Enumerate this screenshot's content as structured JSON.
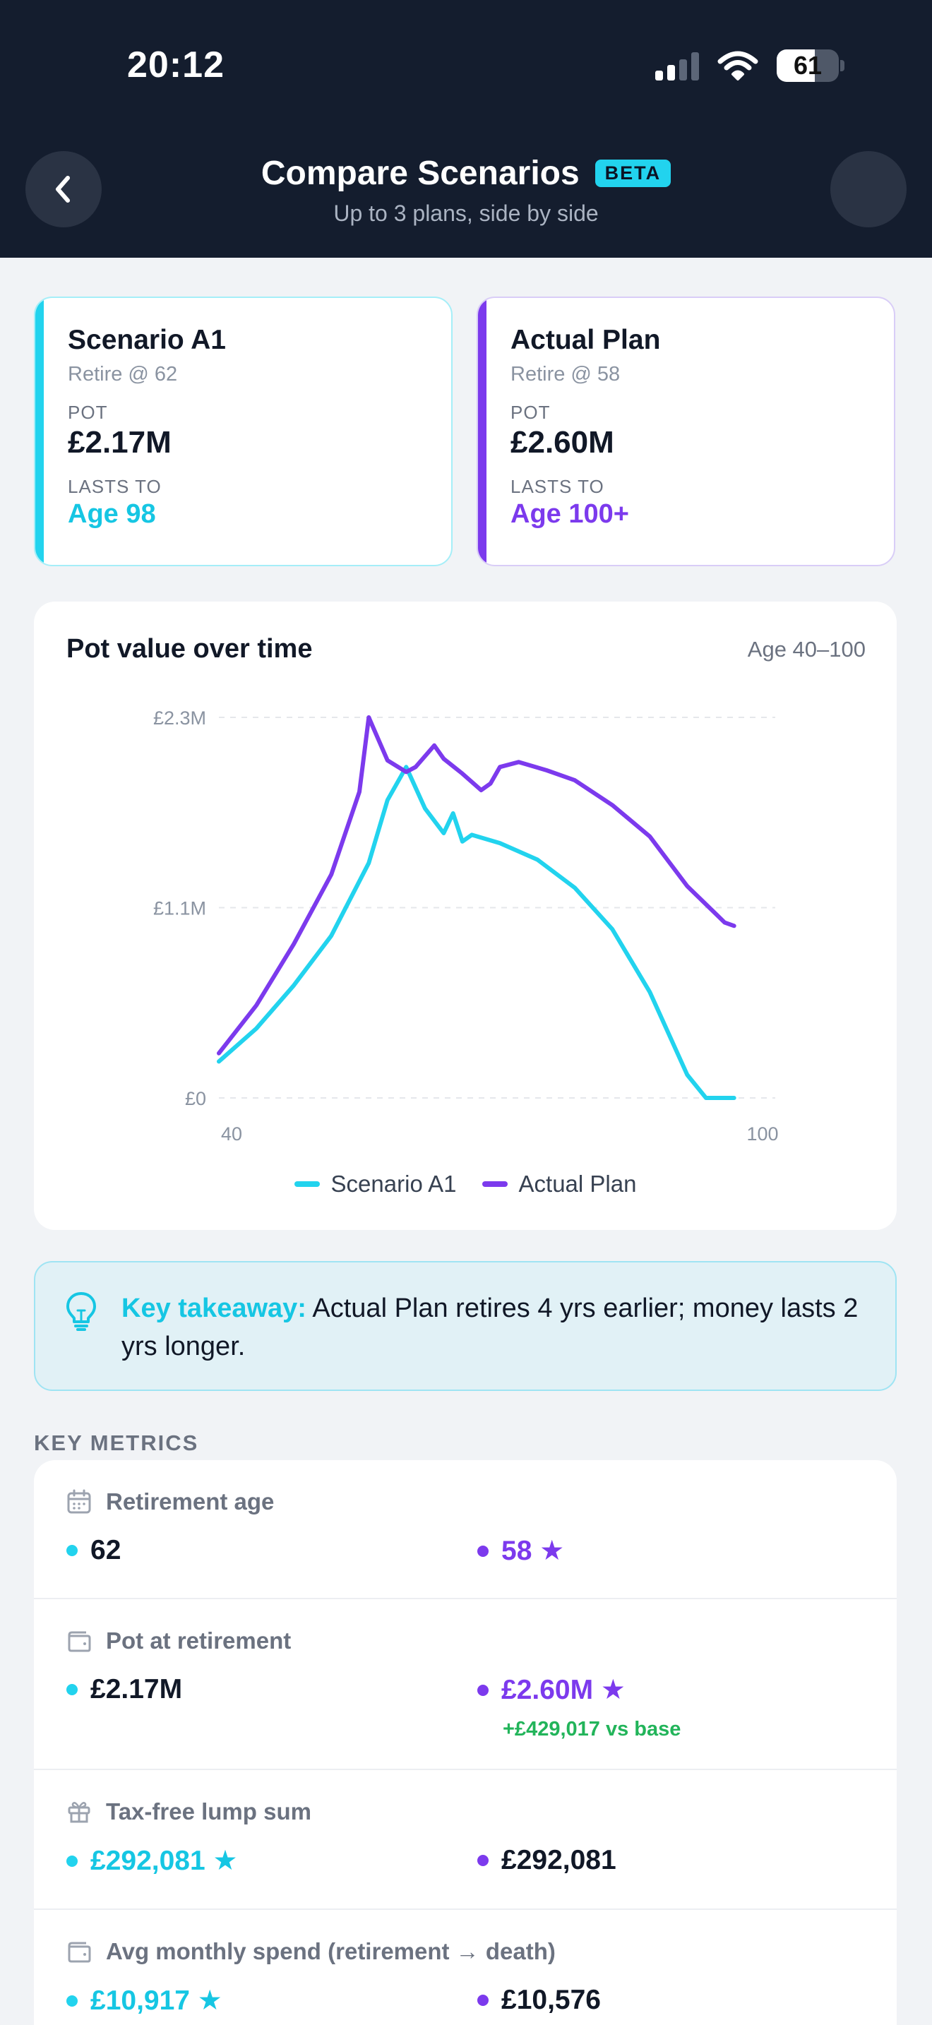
{
  "status_bar": {
    "time": "20:12",
    "battery": "61",
    "battery_level": 0.61
  },
  "header": {
    "title": "Compare Scenarios",
    "badge": "BETA",
    "subtitle": "Up to 3 plans, side by side"
  },
  "scenarios": [
    {
      "name": "Scenario A1",
      "retire": "Retire @ 62",
      "pot_label": "POT",
      "pot": "£2.17M",
      "lasts_label": "LASTS TO",
      "lasts": "Age 98",
      "color": "#22d3ee"
    },
    {
      "name": "Actual Plan",
      "retire": "Retire @ 58",
      "pot_label": "POT",
      "pot": "£2.60M",
      "lasts_label": "LASTS TO",
      "lasts": "Age 100+",
      "color": "#7c3aed"
    }
  ],
  "chart": {
    "title": "Pot value over time",
    "range": "Age 40–100",
    "y_ticks": [
      "£2.3M",
      "£1.1M",
      "£0"
    ],
    "x_ticks": [
      "40",
      "100"
    ]
  },
  "chart_data": {
    "type": "line",
    "title": "Pot value over time",
    "xlabel": "",
    "ylabel": "",
    "xlim": [
      40,
      100
    ],
    "ylim": [
      0,
      2.3
    ],
    "y_unit": "£M",
    "grid": true,
    "legend": "bottom",
    "series": [
      {
        "name": "Scenario A1",
        "color": "#22d3ee",
        "points": [
          [
            40,
            0.22
          ],
          [
            44,
            0.42
          ],
          [
            48,
            0.68
          ],
          [
            52,
            0.98
          ],
          [
            56,
            1.42
          ],
          [
            58,
            1.8
          ],
          [
            60,
            2.0
          ],
          [
            62,
            1.75
          ],
          [
            64,
            1.6
          ],
          [
            65,
            1.72
          ],
          [
            66,
            1.55
          ],
          [
            67,
            1.59
          ],
          [
            70,
            1.54
          ],
          [
            74,
            1.44
          ],
          [
            78,
            1.27
          ],
          [
            82,
            1.02
          ],
          [
            86,
            0.64
          ],
          [
            90,
            0.14
          ],
          [
            92,
            0.0
          ],
          [
            95,
            0.0
          ]
        ]
      },
      {
        "name": "Actual Plan",
        "color": "#7c3aed",
        "points": [
          [
            40,
            0.27
          ],
          [
            44,
            0.56
          ],
          [
            48,
            0.93
          ],
          [
            52,
            1.35
          ],
          [
            55,
            1.85
          ],
          [
            56,
            2.3
          ],
          [
            58,
            2.04
          ],
          [
            60,
            1.97
          ],
          [
            61,
            2.0
          ],
          [
            63,
            2.13
          ],
          [
            64,
            2.05
          ],
          [
            66,
            1.96
          ],
          [
            68,
            1.86
          ],
          [
            69,
            1.9
          ],
          [
            70,
            2.0
          ],
          [
            72,
            2.03
          ],
          [
            75,
            1.98
          ],
          [
            78,
            1.92
          ],
          [
            82,
            1.77
          ],
          [
            86,
            1.58
          ],
          [
            90,
            1.28
          ],
          [
            94,
            1.06
          ],
          [
            95,
            1.04
          ]
        ]
      }
    ]
  },
  "takeaway": {
    "bold": "Key takeaway:",
    "text": " Actual Plan retires 4 yrs earlier; money lasts 2 yrs longer."
  },
  "metrics": {
    "title": "KEY METRICS",
    "rows": [
      {
        "label": "Retirement age",
        "icon": "calendar-icon",
        "a": "62",
        "b": "58 ★",
        "winner": "b"
      },
      {
        "label": "Pot at retirement",
        "icon": "wallet-icon",
        "a": "£2.17M",
        "b": "£2.60M ★",
        "delta": "+£429,017 vs base",
        "winner": "b"
      },
      {
        "label": "Tax-free lump sum",
        "icon": "gift-icon",
        "a": "£292,081 ★",
        "b": "£292,081",
        "winner": "a"
      },
      {
        "label": "Avg monthly spend (retirement → death)",
        "icon": "wallet-icon",
        "a": "£10,917 ★",
        "b": "£10,576",
        "winner": "a"
      }
    ]
  },
  "colors": {
    "scenario_a": "#22d3ee",
    "scenario_b": "#7c3aed",
    "positive": "#22b45a",
    "header_bg": "#141d2e"
  }
}
